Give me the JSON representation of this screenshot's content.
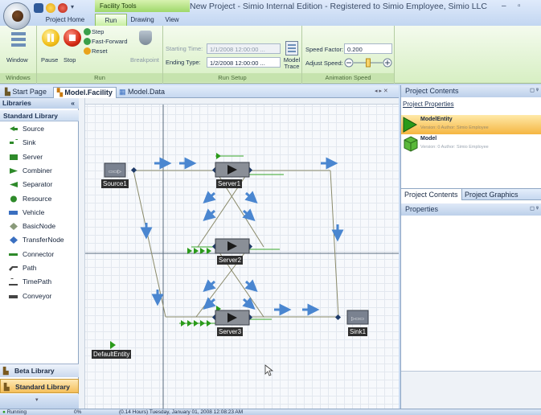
{
  "window": {
    "title": "New Project - Simio Internal Edition - Registered to Simio Employee, Simio LLC",
    "contextual_tab": "Facility Tools",
    "minimize": "–",
    "maximize": "▫"
  },
  "ribbon_tabs": [
    "Project Home",
    "Run",
    "Drawing",
    "View"
  ],
  "ribbon": {
    "windows": {
      "window_label": "Window",
      "group_label": "Windows"
    },
    "run": {
      "pause_label": "Pause",
      "stop_label": "Stop",
      "step_label": "Step",
      "fast_forward_label": "Fast-Forward",
      "reset_label": "Reset",
      "breakpoint_label": "Breakpoint",
      "group_label": "Run"
    },
    "run_setup": {
      "starting_time_label": "Starting Time:",
      "starting_time_value": "1/1/2008 12:00:00 ...",
      "ending_type_label": "Ending Type:",
      "ending_type_value": "1/2/2008 12:00:00 ...",
      "model_trace_label": "Model Trace",
      "group_label": "Run Setup"
    },
    "animation_speed": {
      "speed_factor_label": "Speed Factor:",
      "speed_factor_value": "0.200",
      "adjust_speed_label": "Adjust Speed:",
      "slider_value": 0.5,
      "group_label": "Animation Speed"
    }
  },
  "doc_tabs": [
    "Start Page",
    "Model.Facility",
    "Model.Data"
  ],
  "doc_tab_controls": "◂ ▸ ✕",
  "libraries": {
    "header": "Libraries",
    "collapse": "«",
    "standard_title": "Standard Library",
    "items": [
      {
        "label": "Source",
        "icon": "source-icon",
        "color": "#2e8a2a"
      },
      {
        "label": "Sink",
        "icon": "sink-icon",
        "color": "#2e8a2a"
      },
      {
        "label": "Server",
        "icon": "server-icon",
        "color": "#2e8a2a"
      },
      {
        "label": "Combiner",
        "icon": "combiner-icon",
        "color": "#2e8a2a"
      },
      {
        "label": "Separator",
        "icon": "separator-icon",
        "color": "#2e8a2a"
      },
      {
        "label": "Resource",
        "icon": "resource-icon",
        "color": "#2e8a2a"
      },
      {
        "label": "Vehicle",
        "icon": "vehicle-icon",
        "color": "#3a6fc0"
      },
      {
        "label": "BasicNode",
        "icon": "basicnode-icon",
        "color": "#8a9a7a"
      },
      {
        "label": "TransferNode",
        "icon": "transfernode-icon",
        "color": "#3a6fc0"
      },
      {
        "label": "Connector",
        "icon": "connector-icon",
        "color": "#2e8a2a"
      },
      {
        "label": "Path",
        "icon": "path-icon",
        "color": "#444444"
      },
      {
        "label": "TimePath",
        "icon": "timepath-icon",
        "color": "#444444"
      },
      {
        "label": "Conveyor",
        "icon": "conveyor-icon",
        "color": "#444444"
      }
    ],
    "beta": "Beta Library",
    "standard_bottom": "Standard Library"
  },
  "model": {
    "objects": [
      {
        "label": "Source1"
      },
      {
        "label": "Server1"
      },
      {
        "label": "Server2"
      },
      {
        "label": "Server3"
      },
      {
        "label": "Sink1"
      },
      {
        "label": "DefaultEntity"
      }
    ]
  },
  "project_contents": {
    "header": "Project Contents",
    "link": "Project Properties",
    "items": [
      {
        "name": "ModelEntity",
        "meta": "Version: 0 Author: Simio Employee",
        "selected": true
      },
      {
        "name": "Model",
        "meta": "Version: 0 Author: Simio Employee",
        "selected": false
      }
    ],
    "tabs": [
      "Project Contents",
      "Project Graphics"
    ]
  },
  "properties": {
    "header": "Properties"
  },
  "panel_pin": "◻ ᵠ",
  "status": {
    "state": "Running",
    "percent": "0%",
    "time": "(0.14 Hours) Tuesday, January 01, 2008 12:08:23 AM"
  },
  "colors": {
    "ribbon_accent": "#9ed86a",
    "entity_green": "#2a9a1a",
    "flow_blue": "#4a86d0",
    "selected_item": "#f5b642"
  }
}
